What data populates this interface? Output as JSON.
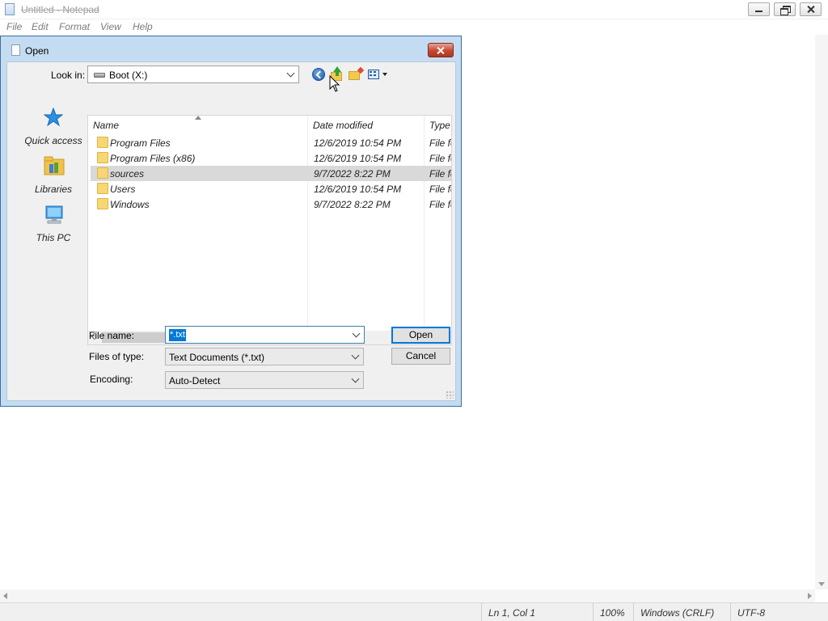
{
  "notepad": {
    "title": "Untitled - Notepad",
    "menu": [
      "File",
      "Edit",
      "Format",
      "View",
      "Help"
    ],
    "status": {
      "position": "Ln 1, Col 1",
      "zoom": "100%",
      "line_endings": "Windows (CRLF)",
      "encoding": "UTF-8"
    }
  },
  "dialog": {
    "title": "Open",
    "look_in_label": "Look in:",
    "look_in_value": "Boot (X:)",
    "places": [
      {
        "label": "Quick access",
        "icon": "star-icon"
      },
      {
        "label": "Libraries",
        "icon": "libraries-icon"
      },
      {
        "label": "This PC",
        "icon": "computer-icon"
      }
    ],
    "columns": {
      "name": "Name",
      "date": "Date modified",
      "type": "Type"
    },
    "files": [
      {
        "name": "Program Files",
        "date": "12/6/2019 10:54 PM",
        "type": "File fo",
        "selected": false
      },
      {
        "name": "Program Files (x86)",
        "date": "12/6/2019 10:54 PM",
        "type": "File fo",
        "selected": false
      },
      {
        "name": "sources",
        "date": "9/7/2022 8:22 PM",
        "type": "File fo",
        "selected": true
      },
      {
        "name": "Users",
        "date": "12/6/2019 10:54 PM",
        "type": "File fo",
        "selected": false
      },
      {
        "name": "Windows",
        "date": "9/7/2022 8:22 PM",
        "type": "File fo",
        "selected": false
      }
    ],
    "file_name_label": "File name:",
    "file_name_value": "*.txt",
    "files_of_type_label": "Files of type:",
    "files_of_type_value": "Text Documents (*.txt)",
    "encoding_label": "Encoding:",
    "encoding_value": "Auto-Detect",
    "open_button": "Open",
    "cancel_button": "Cancel"
  },
  "colors": {
    "dialog_frame": "#c4dcf2",
    "selection": "#0078d7",
    "close_button": "#c6472f",
    "row_selected": "#d9d9d9"
  }
}
